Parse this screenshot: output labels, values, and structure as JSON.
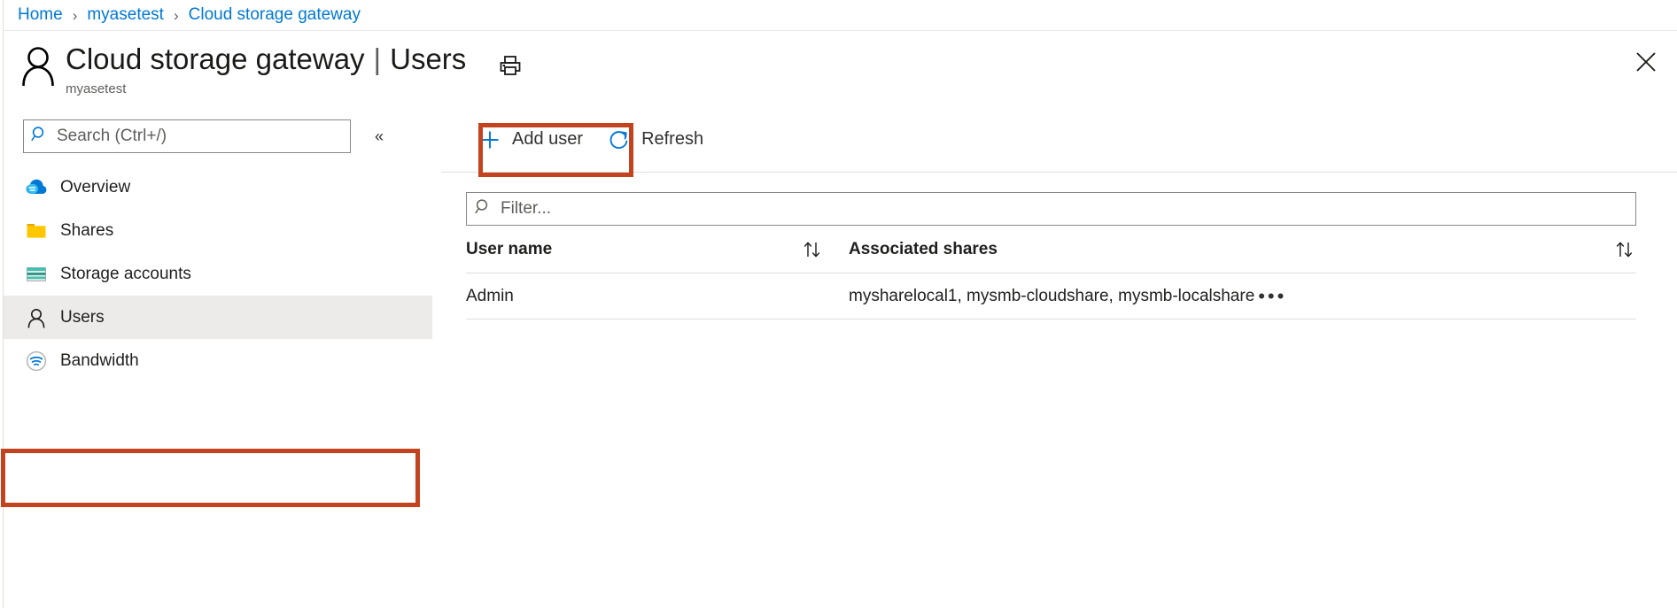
{
  "breadcrumb": {
    "items": [
      {
        "label": "Home"
      },
      {
        "label": "myasetest"
      },
      {
        "label": "Cloud storage gateway"
      }
    ],
    "separator": "›"
  },
  "header": {
    "avatar_icon": "person-icon",
    "title": "Cloud storage gateway",
    "title_separator": "|",
    "subtitle_tab": "Users",
    "resource_name": "myasetest",
    "print_icon": "printer-icon",
    "close_icon": "close-icon"
  },
  "sidebar": {
    "search": {
      "placeholder": "Search (Ctrl+/)",
      "value": "",
      "icon": "search-icon"
    },
    "collapse_icon": "chevron-double-left-icon",
    "collapse_glyph": "«",
    "items": [
      {
        "label": "Overview",
        "icon": "cloud-icon",
        "selected": false
      },
      {
        "label": "Shares",
        "icon": "folder-icon",
        "selected": false
      },
      {
        "label": "Storage accounts",
        "icon": "storage-account-icon",
        "selected": false
      },
      {
        "label": "Users",
        "icon": "person-icon",
        "selected": true
      },
      {
        "label": "Bandwidth",
        "icon": "bandwidth-wifi-icon",
        "selected": false
      }
    ]
  },
  "toolbar": {
    "add_user_label": "Add user",
    "add_user_icon": "plus-icon",
    "refresh_label": "Refresh",
    "refresh_icon": "refresh-icon"
  },
  "filter": {
    "placeholder": "Filter...",
    "value": "",
    "icon": "search-icon"
  },
  "table": {
    "columns": [
      {
        "label": "User name",
        "sort_icon": "sort-updown-icon"
      },
      {
        "label": "Associated shares",
        "sort_icon": "sort-updown-icon"
      }
    ],
    "rows": [
      {
        "user_name": "Admin",
        "associated_shares": "mysharelocal1, mysmb-cloudshare, mysmb-localshare",
        "menu_glyph": "•••",
        "menu_icon": "more-options-icon"
      }
    ]
  },
  "annotations": {
    "add_user_highlight_color": "#c3431f",
    "users_nav_highlight_color": "#c3431f"
  },
  "colors": {
    "link": "#0078d4",
    "accent": "#0078d4",
    "selected_row_bg": "#edebe9",
    "border": "#e1dfdd",
    "text": "#201f1e",
    "muted_text": "#605e5c"
  }
}
